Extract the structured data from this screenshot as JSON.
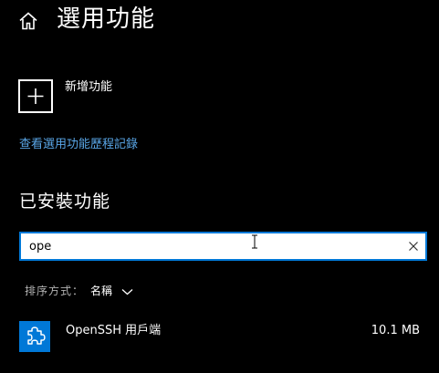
{
  "header": {
    "title": "選用功能",
    "home_icon": "home-icon"
  },
  "add_feature": {
    "label": "新增功能",
    "icon": "plus-icon"
  },
  "history_link": "查看選用功能歷程記錄",
  "installed": {
    "heading": "已安裝功能",
    "search": {
      "value": "ope",
      "clear_icon": "close-icon"
    },
    "sort": {
      "label": "排序方式：",
      "value": "名稱",
      "icon": "chevron-down-icon"
    },
    "items": [
      {
        "name": "OpenSSH 用戶端",
        "size": "10.1 MB",
        "icon": "puzzle-icon"
      }
    ]
  },
  "colors": {
    "background": "#000000",
    "accent": "#0078d7",
    "link": "#5aa7e8",
    "text": "#ffffff",
    "muted_text": "#b3b3b3"
  }
}
